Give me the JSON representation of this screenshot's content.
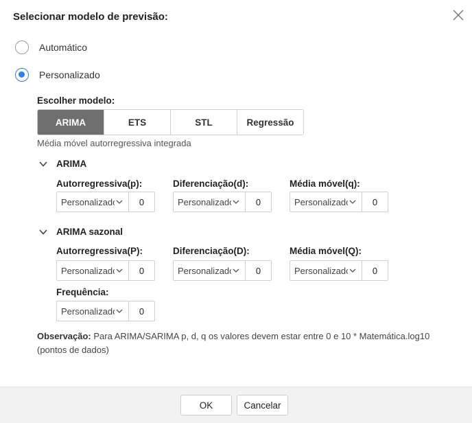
{
  "dialog": {
    "title": "Selecionar modelo de previsão:",
    "close_icon": "close-icon"
  },
  "mode": {
    "options": [
      {
        "label": "Automático",
        "selected": false
      },
      {
        "label": "Personalizado",
        "selected": true
      }
    ]
  },
  "model_chooser": {
    "label": "Escolher modelo:",
    "tabs": [
      {
        "label": "ARIMA",
        "active": true
      },
      {
        "label": "ETS",
        "active": false
      },
      {
        "label": "STL",
        "active": false
      },
      {
        "label": "Regressão",
        "active": false
      }
    ],
    "description": "Média móvel autorregressiva integrada"
  },
  "arima": {
    "title": "ARIMA",
    "fields": [
      {
        "label": "Autorregressiva(p):",
        "select": "Personalizado",
        "value": "0"
      },
      {
        "label": "Diferenciação(d):",
        "select": "Personalizado",
        "value": "0"
      },
      {
        "label": "Média móvel(q):",
        "select": "Personalizado",
        "value": "0"
      }
    ]
  },
  "seasonal": {
    "title": "ARIMA sazonal",
    "fields": [
      {
        "label": "Autorregressiva(P):",
        "select": "Personalizado",
        "value": "0"
      },
      {
        "label": "Diferenciação(D):",
        "select": "Personalizado",
        "value": "0"
      },
      {
        "label": "Média móvel(Q):",
        "select": "Personalizado",
        "value": "0"
      }
    ],
    "frequency": {
      "label": "Frequência:",
      "select": "Personalizado",
      "value": "0"
    }
  },
  "note": {
    "label": "Observação:",
    "text": "Para ARIMA/SARIMA p, d, q os valores devem estar entre 0 e 10 * Matemática.log10 (pontos de dados)"
  },
  "footer": {
    "ok_label": "OK",
    "cancel_label": "Cancelar"
  },
  "colors": {
    "accent": "#2f80ed",
    "active_tab": "#6f6f6f",
    "footer_bg": "#f2f2f2"
  }
}
